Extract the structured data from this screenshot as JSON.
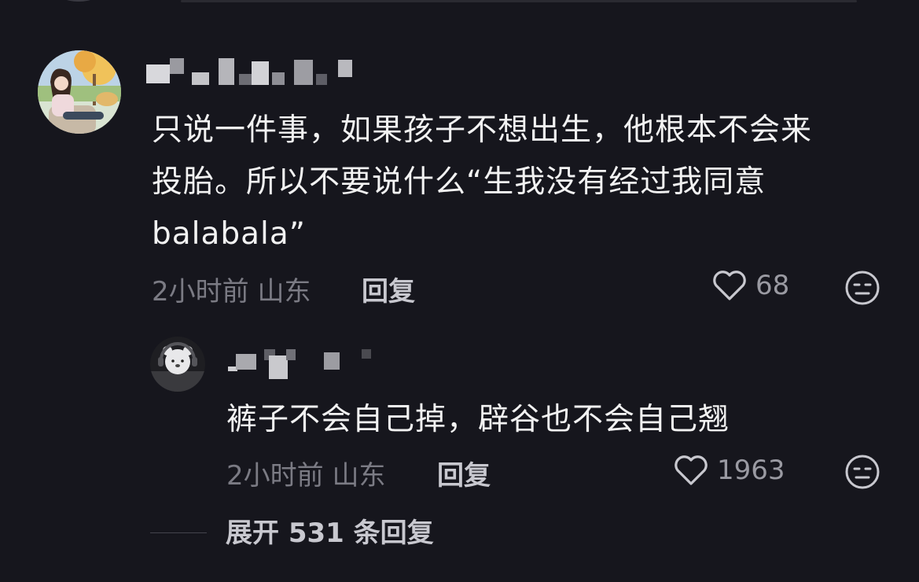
{
  "comments": [
    {
      "text_lines": [
        "只说一件事，如果孩子不想出生，他根本不会来",
        "投胎。所以不要说什么“生我没有经过我同意",
        "balabala”"
      ],
      "time": "2小时前",
      "location": "山东",
      "reply_label": "回复",
      "likes": "68",
      "like_icon": "heart-outline-icon",
      "reaction_icon": "neutral-face-icon"
    },
    {
      "text_lines": [
        "裤子不会自己掉，辟谷也不会自己翘"
      ],
      "time": "2小时前",
      "location": "山东",
      "reply_label": "回复",
      "likes": "1963",
      "like_icon": "heart-outline-icon",
      "reaction_icon": "neutral-face-icon"
    }
  ],
  "expand_replies": "展开 531 条回复",
  "colors": {
    "background": "#16161d",
    "text": "#f2f2f2",
    "meta": "#7b7b84",
    "action": "#c8c8cf"
  }
}
